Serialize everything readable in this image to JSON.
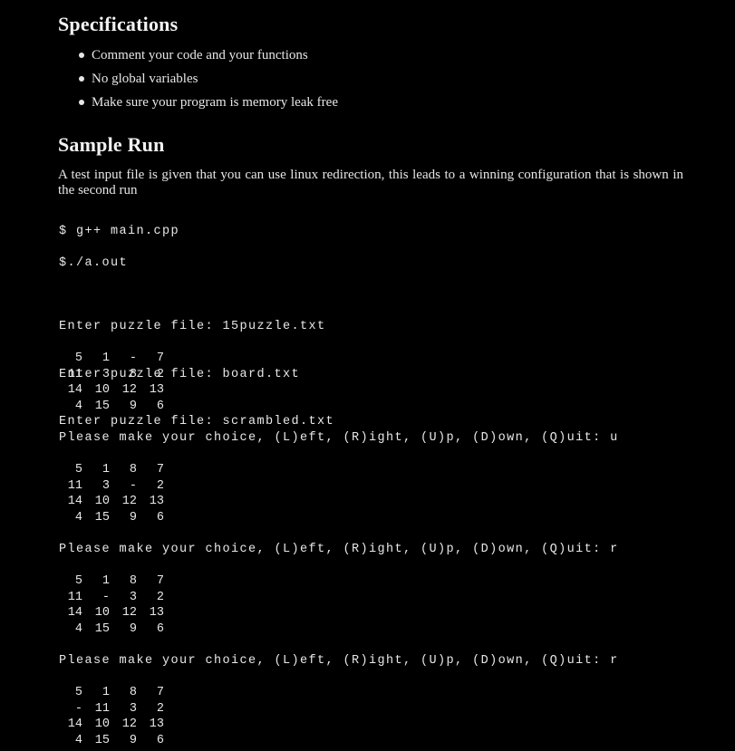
{
  "specifications": {
    "heading": "Specifications",
    "items": [
      "Comment your code and your functions",
      "No global variables",
      "Make sure your program is memory leak free"
    ]
  },
  "sample_run": {
    "heading": "Sample Run",
    "description": "A test input file is given that you can use linux redirection, this leads to a winning configuration that is shown in the second run",
    "commands": [
      "$ g++ main.cpp",
      "$./a.out"
    ],
    "file_prompts": [
      "Enter puzzle file: 15puzzle.txt",
      "Enter puzzle file: board.txt",
      "Enter puzzle file: scrambled.txt"
    ],
    "boards": [
      [
        [
          "5",
          "1",
          "-",
          "7"
        ],
        [
          "11",
          "3",
          "8",
          "2"
        ],
        [
          "14",
          "10",
          "12",
          "13"
        ],
        [
          "4",
          "15",
          "9",
          "6"
        ]
      ],
      [
        [
          "5",
          "1",
          "8",
          "7"
        ],
        [
          "11",
          "3",
          "-",
          "2"
        ],
        [
          "14",
          "10",
          "12",
          "13"
        ],
        [
          "4",
          "15",
          "9",
          "6"
        ]
      ],
      [
        [
          "5",
          "1",
          "8",
          "7"
        ],
        [
          "11",
          "-",
          "3",
          "2"
        ],
        [
          "14",
          "10",
          "12",
          "13"
        ],
        [
          "4",
          "15",
          "9",
          "6"
        ]
      ],
      [
        [
          "5",
          "1",
          "8",
          "7"
        ],
        [
          "-",
          "11",
          "3",
          "2"
        ],
        [
          "14",
          "10",
          "12",
          "13"
        ],
        [
          "4",
          "15",
          "9",
          "6"
        ]
      ]
    ],
    "choice_prompts": [
      "Please make your choice, (L)eft, (R)ight, (U)p, (D)own, (Q)uit: u",
      "Please make your choice, (L)eft, (R)ight, (U)p, (D)own, (Q)uit: r",
      "Please make your choice, (L)eft, (R)ight, (U)p, (D)own, (Q)uit: r"
    ]
  }
}
